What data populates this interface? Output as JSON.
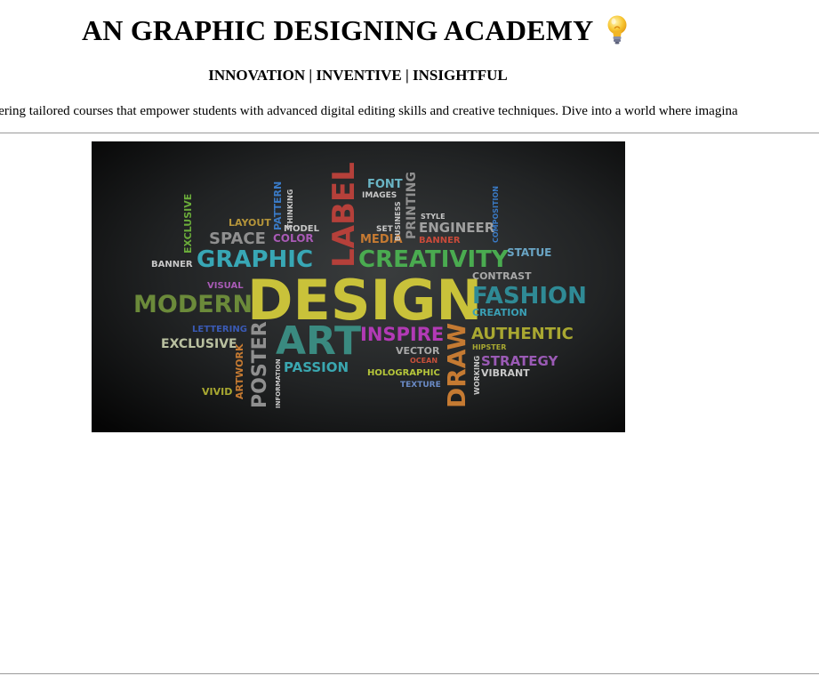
{
  "header": {
    "title": "AN GRAPHIC DESIGNING ACADEMY",
    "title_icon": "lightbulb-icon",
    "tagline": "INNOVATION | INVENTIVE | INSIGHTFUL"
  },
  "marquee": {
    "text": "p, offering tailored courses that empower students with advanced digital editing skills and creative techniques. Dive into a world where imagina"
  },
  "hero_image": {
    "words": {
      "design": "DESIGN",
      "art": "ART",
      "graphic": "GRAPHIC",
      "creativity": "CREATIVITY",
      "fashion": "FASHION",
      "modern": "MODERN",
      "label": "LABEL",
      "draw": "DRAW",
      "poster": "POSTER",
      "inspire": "INSPIRE",
      "authentic": "AUTHENTIC",
      "strategy": "STRATEGY",
      "passion": "PASSION",
      "exclusive_h": "EXCLUSIVE",
      "exclusive_v": "EXCLUSIVE",
      "space": "SPACE",
      "layout": "LAYOUT",
      "banner_l": "BANNER",
      "banner_r": "BANNER",
      "pattern": "PATTERN",
      "thinking": "THINKING",
      "model": "MODEL",
      "color": "COLOR",
      "font": "FONT",
      "images": "IMAGES",
      "printing": "PRINTING",
      "business": "BUSINESS",
      "set": "SET",
      "media": "MEDIA",
      "style": "STYLE",
      "engineer": "ENGINEER",
      "composition": "COMPOSITION",
      "statue": "STATUE",
      "visual": "VISUAL",
      "contrast": "CONTRAST",
      "creation": "CREATION",
      "lettering": "LETTERING",
      "vector": "VECTOR",
      "ocean": "OCEAN",
      "hipster": "HIPSTER",
      "holographic": "HOLOGRAPHIC",
      "vibrant": "VIBRANT",
      "texture": "TEXTURE",
      "working": "WORKING",
      "vivid": "VIVID",
      "artwork": "ARTWORK",
      "information": "INFORMATION"
    }
  }
}
